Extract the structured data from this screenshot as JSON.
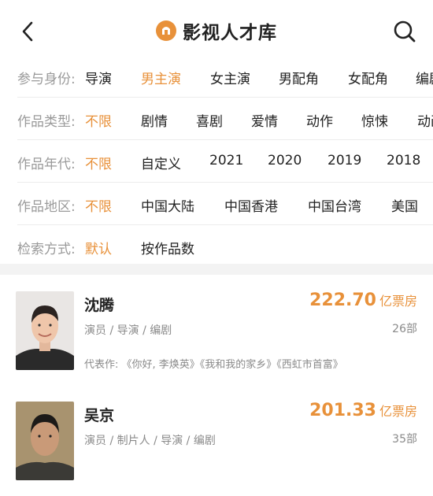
{
  "header": {
    "title": "影视人才库"
  },
  "filters": [
    {
      "label": "参与身份:",
      "options": [
        "导演",
        "男主演",
        "女主演",
        "男配角",
        "女配角",
        "编剧"
      ],
      "active": 1
    },
    {
      "label": "作品类型:",
      "options": [
        "不限",
        "剧情",
        "喜剧",
        "爱情",
        "动作",
        "惊悚",
        "动画"
      ],
      "active": 0
    },
    {
      "label": "作品年代:",
      "options": [
        "不限",
        "自定义",
        "2021",
        "2020",
        "2019",
        "2018"
      ],
      "active": 0
    },
    {
      "label": "作品地区:",
      "options": [
        "不限",
        "中国大陆",
        "中国香港",
        "中国台湾",
        "美国"
      ],
      "active": 0
    },
    {
      "label": "检索方式:",
      "options": [
        "默认",
        "按作品数"
      ],
      "active": 0
    }
  ],
  "results": [
    {
      "name": "沈腾",
      "roles": "演员 / 导演 / 编剧",
      "box_office": "222.70",
      "box_office_unit": "亿票房",
      "works_count": "26部",
      "representative": "代表作: 《你好, 李焕英》《我和我的家乡》《西虹市首富》"
    },
    {
      "name": "吴京",
      "roles": "演员 / 制片人 / 导演 / 编剧",
      "box_office": "201.33",
      "box_office_unit": "亿票房",
      "works_count": "35部",
      "representative": ""
    }
  ],
  "colors": {
    "accent": "#e8913a",
    "muted": "#9a9a9a",
    "divider": "#f3f3f3"
  }
}
